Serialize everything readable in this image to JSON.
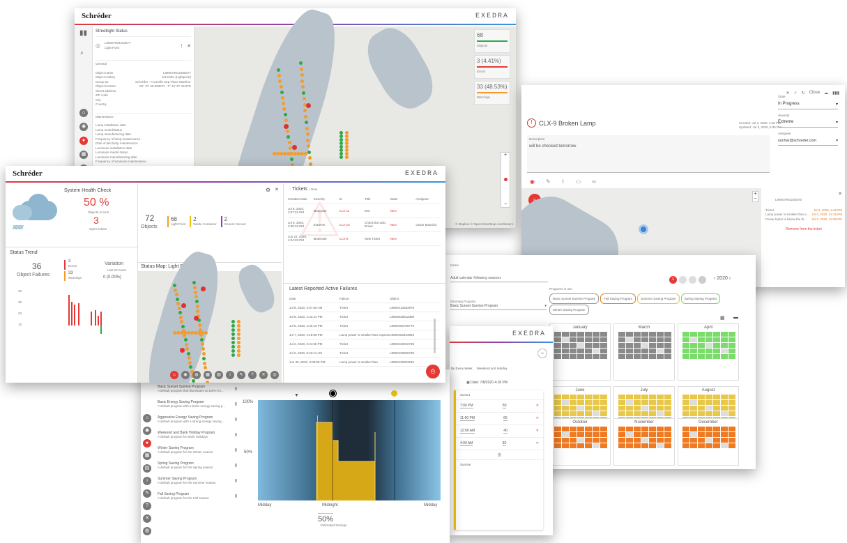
{
  "brand": "Schréder",
  "exedra": "EXEDRA",
  "panel_streetlight": {
    "title": "Streetlight Status",
    "device_id": "L8900790423057T",
    "device_type": "Light Point",
    "general_label": "General",
    "general_fields": [
      "Object name",
      "Object Hotkey",
      "Group as",
      "Object location",
      "Street address",
      "ZIP code",
      "City",
      "Country"
    ],
    "general_values": [
      "L890079042305077",
      "Schréder (Lightpoint)",
      "Schréder - Fuzeville Sep Place Madrine Point ok",
      "50° 37' 55.6936\"N - 5° 34' 37.3120\"E",
      "",
      "",
      "",
      ""
    ],
    "maintenance_label": "Maintenance",
    "maintenance_fields": [
      "Lamp installation date",
      "Lamp model/status",
      "Lamp manufacturing date",
      "Frequency of lamp maintenance",
      "Date of last lamp maintenance",
      "Luminaire installation date",
      "Luminaire model status",
      "Luminaire manufacturing date",
      "Frequency of luminaire maintenance"
    ],
    "stats": [
      {
        "value": "68",
        "label": "Objects",
        "color": "#2ea84a"
      },
      {
        "value": "3 (4.41%)",
        "label": "Errors",
        "color": "#e53935"
      },
      {
        "value": "33 (48.53%)",
        "label": "Warnings",
        "color": "#f39c2c"
      }
    ],
    "map_credit": "© Mapbox © OpenStreetMap contributors"
  },
  "panel_ticket": {
    "toolbar_label": "Close",
    "title": "CLX-9 Broken Lamp",
    "created": "Created: Jul 3, 2020, 4:48 PM",
    "updated": "Updated: Jul 3, 2020, 5:35 PM",
    "description_label": "Description",
    "description": "will be checked tomorrow",
    "state_label": "State",
    "state": "In Progress",
    "severity_label": "Severity",
    "severity": "Extreme",
    "assignee_label": "Assignee",
    "assignee": "yochar@schreder.com",
    "device_id": "L8900790423057B",
    "events": [
      {
        "label": "Ticket",
        "time": "Jul 3, 2020, 4:48 PM"
      },
      {
        "label": "Lamp power is smaller than e...",
        "time": "Jul 3, 2020, 12:15 PM"
      },
      {
        "label": "Power factor is below the th...",
        "time": "Jul 3, 2020, 12:06 PM"
      }
    ],
    "remove_label": "Remove from the ticket"
  },
  "panel_dashboard": {
    "health_title": "System Health Check",
    "health_percent": "50 %",
    "health_sub": "Objects in error",
    "health_count": "3",
    "health_count_label": "Open tickets",
    "trend_title": "Status Trend",
    "failures_value": "36",
    "failures_label": "Object Failures",
    "errors_value": "3",
    "errors_label": "Errors",
    "warnings_value": "33",
    "warnings_label": "Warnings",
    "variation_label": "Variation",
    "variation_sub": "Last 24 hours",
    "variation_value": "0 (0.00%)",
    "y_ticks": [
      "40",
      "30",
      "20",
      "10"
    ],
    "objects_value": "72",
    "objects_label": "Objects",
    "breakdown": [
      {
        "value": "68",
        "label": "Light Point",
        "color": "#f39c2c"
      },
      {
        "value": "2",
        "label": "Waste Container",
        "color": "#f1c40f"
      },
      {
        "value": "2",
        "label": "Generic Sensor",
        "color": "#8e44ad"
      }
    ],
    "map_title": "Status Map: Light Point",
    "tickets_title": "Tickets",
    "tickets_sub": "New",
    "ticket_cols": [
      "Creation Date",
      "Severity",
      "Id",
      "Title",
      "State",
      "Assignee"
    ],
    "tickets": [
      {
        "date": "Jul 8, 2020, 3:07:31 PM",
        "sev": "Moderate",
        "id": "CLX-11",
        "title": "test",
        "state": "New",
        "assignee": ""
      },
      {
        "date": "Jul 8, 2020, 2:30:10 PM",
        "sev": "Extreme",
        "id": "CLX-10",
        "title": "Check the LED Driver",
        "state": "New",
        "assignee": "Cesar Mauricio"
      },
      {
        "date": "Jun 22, 2020, 4:04:20 PM",
        "sev": "Moderate",
        "id": "CLX-8",
        "title": "New Ticket",
        "state": "New",
        "assignee": ""
      }
    ],
    "failures_title": "Latest Reported Active Failures",
    "failure_cols": [
      "Date",
      "Failure",
      "Object"
    ],
    "failures": [
      {
        "date": "Jul 8, 2020, 3:07:50 AM",
        "failure": "Ticket",
        "object": "L8900413083978"
      },
      {
        "date": "Jul 8, 2020, 2:42:24 PM",
        "failure": "Ticket",
        "object": "L8900638022388"
      },
      {
        "date": "Jul 8, 2020, 2:30:10 PM",
        "failure": "Ticket",
        "object": "L8900483789776"
      },
      {
        "date": "Jul 7, 2020, 4:18:08 PM",
        "failure": "Lamp power is smaller than expected lamp power",
        "object": "L8900483453963"
      },
      {
        "date": "Jul 2, 2020, 2:24:58 PM",
        "failure": "Ticket",
        "object": "L8900430032738"
      },
      {
        "date": "Jul 2, 2020, 5:43:11 AM",
        "failure": "Ticket",
        "object": "L8900430066799"
      },
      {
        "date": "Jun 30, 2020, 3:08:05 PM",
        "failure": "Lamp power is smaller than",
        "object": "L8900430002533"
      }
    ]
  },
  "panel_calendar": {
    "search_placeholder": "Search",
    "name_label": "Name",
    "name_value": "Adult calendar following seasons",
    "program_label": "Dimming Program",
    "program_value": "Basic Sunset Sunrise Program",
    "year": "2020",
    "chips_label": "Programs in use",
    "chips": [
      {
        "label": "Basic Sunset Sunrise Program",
        "color": "#999"
      },
      {
        "label": "Fall Saving Program",
        "color": "#e67e22"
      },
      {
        "label": "Summer Saving Program",
        "color": "#e8c23a"
      },
      {
        "label": "Spring Saving Program",
        "color": "#7bd36b"
      },
      {
        "label": "Winter Saving Program",
        "color": "#999"
      }
    ],
    "months": [
      "January",
      "March",
      "April",
      "June",
      "July",
      "August",
      "October",
      "November",
      "December"
    ]
  },
  "panel_dimming": {
    "date_label": "Date: 7/8/2020 4:18 PM",
    "tabs": [
      "By Every Week",
      "Weekend and Holiday"
    ],
    "steps": [
      {
        "time": "7:00 PM",
        "level": "80"
      },
      {
        "time": "11:00 PM",
        "level": "65"
      },
      {
        "time": "12:00 AM",
        "level": "40"
      },
      {
        "time": "4:00 AM",
        "level": "80"
      }
    ],
    "start_label": "Sunset",
    "end_label": "Sunrise"
  },
  "panel_programs": {
    "programs": [
      {
        "name": "Basic Sunset Sunrise Program",
        "desc": "A default program that illuminates at 100% fro..."
      },
      {
        "name": "Basic Energy Saving Program",
        "desc": "A default program with a basic energy saving p..."
      },
      {
        "name": "Aggressive Energy Saving Program",
        "desc": "A default program with a strong energy saving..."
      },
      {
        "name": "Weekend and Bank Holiday Program",
        "desc": "A default program for Bank Holidays"
      },
      {
        "name": "Winter Saving Program",
        "desc": "A default program for the Winter season"
      },
      {
        "name": "Spring Saving Program",
        "desc": "A default program for the Spring season"
      },
      {
        "name": "Summer Saving Program",
        "desc": "A default program for the Summer season"
      },
      {
        "name": "Fall Saving Program",
        "desc": "A default program for the Fall season"
      }
    ],
    "y_100": "100%",
    "y_50": "50%",
    "x_labels": [
      "Midday",
      "Midnight",
      "Midday"
    ],
    "savings_value": "50%",
    "savings_label": "Estimated Savings"
  }
}
